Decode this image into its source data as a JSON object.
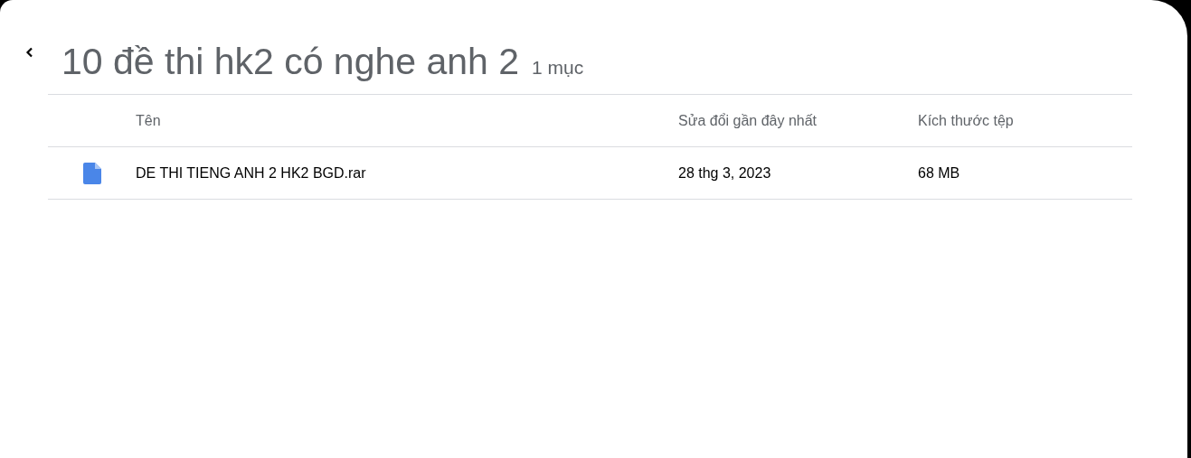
{
  "folder": {
    "title": "10 đề thi hk2 có nghe anh 2",
    "count": "1 mục"
  },
  "table": {
    "columns": [
      "Tên",
      "Sửa đổi gần đây nhất",
      "Kích thước tệp"
    ],
    "rows": [
      {
        "kind": "file",
        "name": "DE THI TIENG ANH 2 HK2 BGD.rar",
        "modified": "28 thg 3, 2023",
        "size": "68 MB"
      }
    ]
  }
}
